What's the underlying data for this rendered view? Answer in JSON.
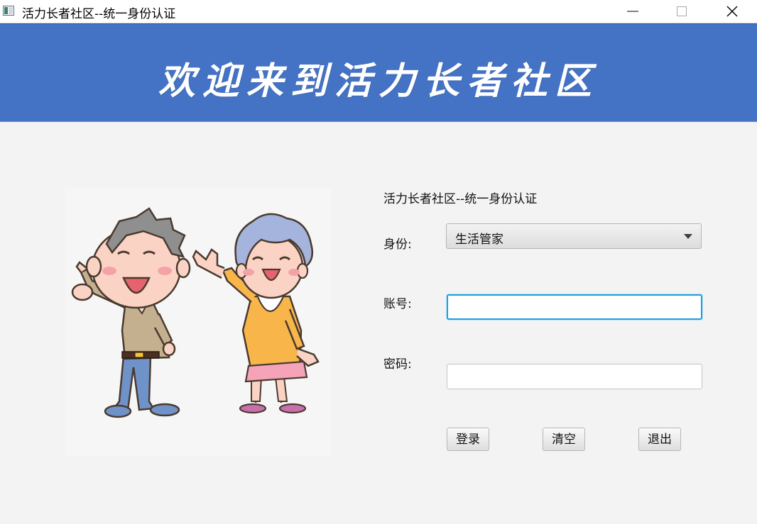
{
  "window": {
    "title": "活力长者社区--统一身份认证",
    "controls": [
      "minimize",
      "maximize",
      "close"
    ]
  },
  "banner": {
    "text": "欢迎来到活力长者社区",
    "background": "#4472c4"
  },
  "illustration": {
    "icon": "elderly-couple-illustration"
  },
  "form": {
    "title": "活力长者社区--统一身份认证",
    "identity_label": "身份:",
    "identity_value": "生活管家",
    "account_label": "账号:",
    "account_value": "",
    "password_label": "密码:",
    "password_value": ""
  },
  "buttons": {
    "login": "登录",
    "clear": "清空",
    "exit": "退出"
  }
}
